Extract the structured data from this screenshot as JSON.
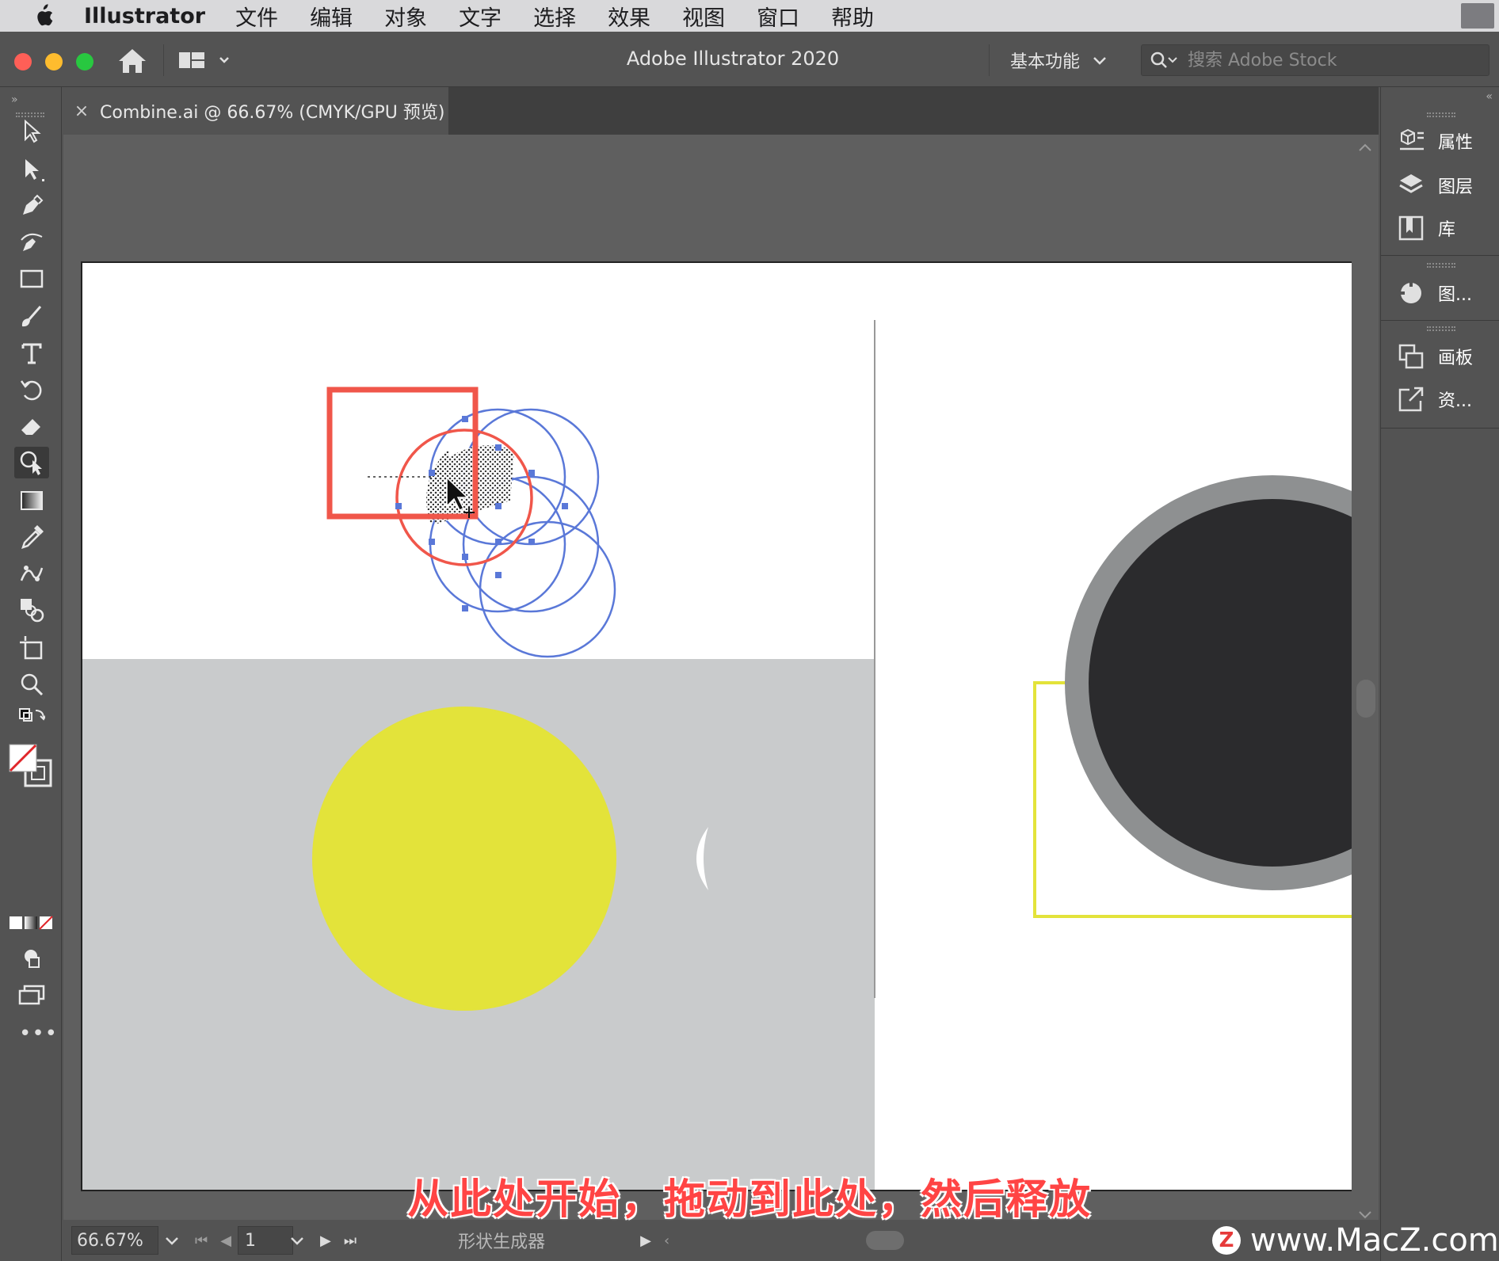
{
  "menubar": {
    "app_name": "Illustrator",
    "items": [
      "文件",
      "编辑",
      "对象",
      "文字",
      "选择",
      "效果",
      "视图",
      "窗口",
      "帮助"
    ]
  },
  "titlebar": {
    "title": "Adobe Illustrator 2020",
    "workspace": "基本功能",
    "search_placeholder": "搜索 Adobe Stock"
  },
  "document_tab": {
    "close": "×",
    "label": "Combine.ai @ 66.67% (CMYK/GPU 预览)"
  },
  "right_panel": {
    "items": [
      "属性",
      "图层",
      "库",
      "图...",
      "画板",
      "资..."
    ]
  },
  "statusbar": {
    "zoom": "66.67%",
    "page": "1",
    "tool_name": "形状生成器"
  },
  "caption": "从此处开始，拖动到此处，然后释放",
  "watermark": {
    "logo": "Z",
    "text": "www.MacZ.com"
  },
  "colors": {
    "ui_bg": "#535353",
    "canvas_bg": "#5f5f5f",
    "yellow": "#e3e33a",
    "dark_circle": "#2b2b2d",
    "ring_gray": "#8e9091",
    "selection_blue": "#5a78d8",
    "highlight_red": "#f0564a",
    "lower_panel_gray": "#c9cbcc"
  }
}
